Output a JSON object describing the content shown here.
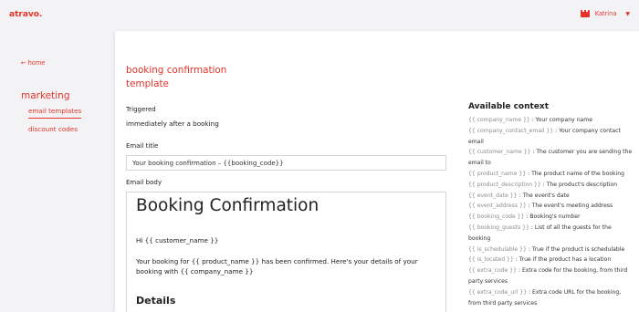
{
  "header": {
    "logo": "atravo.",
    "user_name": "Katrina"
  },
  "sidebar": {
    "back_link": "← home",
    "section": "marketing",
    "items": [
      {
        "label": "email templates",
        "active": true
      },
      {
        "label": "discount codes",
        "active": false
      }
    ]
  },
  "main": {
    "title_line1": "booking confirmation",
    "title_line2": "template",
    "triggered_label": "Triggered",
    "triggered_value": "immediately after a booking",
    "email_title_label": "Email title",
    "email_title_value": "Your booking confirmation – {{booking_code}}",
    "email_body_label": "Email body",
    "body": {
      "heading": "Booking Confirmation",
      "greeting": "Hi {{ customer_name }}",
      "paragraph": "Your booking for {{ product_name }} has been confirmed. Here's your details of your booking with {{ company_name }}",
      "subheading": "Details"
    }
  },
  "context": {
    "title": "Available context",
    "items": [
      {
        "key": "{{ company_name }}",
        "desc": " : Your company name"
      },
      {
        "key": "{{ company_contact_email }}",
        "desc": " : Your company contact email"
      },
      {
        "key": "{{ customer_name }}",
        "desc": " : The customer you are sending the email to"
      },
      {
        "key": "{{ product_name }}",
        "desc": " : The product name of the booking"
      },
      {
        "key": "{{ product_description }}",
        "desc": " : The product's description"
      },
      {
        "key": "{{ event_date }}",
        "desc": " : The event's date"
      },
      {
        "key": "{{ event_address }}",
        "desc": " : The event's meeting address"
      },
      {
        "key": "{{ booking_code }}",
        "desc": " : Booking's number"
      },
      {
        "key": "{{ booking_guests }}",
        "desc": " : List of all the guests for the booking"
      },
      {
        "key": "{{ is_schedulable }}",
        "desc": " : True if the product is schedulable"
      },
      {
        "key": "{{ is_located }}",
        "desc": " : True if the product has a location"
      },
      {
        "key": "{{ extra_code }}",
        "desc": " : Extra code for the booking, from third party services"
      },
      {
        "key": "{{ extra_code_url }}",
        "desc": " : Extra code URL for the booking, from third party services"
      }
    ]
  },
  "colors": {
    "accent": "#e5332a",
    "background": "#f3f3f5",
    "panel": "#ffffff"
  }
}
